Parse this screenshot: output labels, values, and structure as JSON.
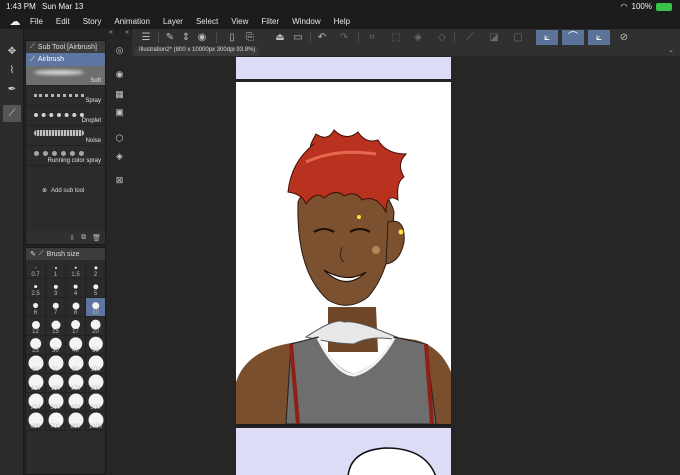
{
  "status": {
    "time": "1:43 PM",
    "date": "Sun Mar 13",
    "battery": "100%"
  },
  "menu": [
    "File",
    "Edit",
    "Story",
    "Animation",
    "Layer",
    "Select",
    "View",
    "Filter",
    "Window",
    "Help"
  ],
  "subtool": {
    "header": "Sub Tool [Airbrush]",
    "group": "Airbrush",
    "brushes": [
      "Soft",
      "Spray",
      "Droplet",
      "Noise",
      "Running color spray"
    ],
    "add_label": "Add sub tool"
  },
  "brushsize": {
    "header": "Brush size",
    "sizes": [
      "0.7",
      "1",
      "1.5",
      "2",
      "2.5",
      "3",
      "4",
      "5",
      "6",
      "7",
      "8",
      "10",
      "12",
      "15",
      "17",
      "20",
      "25",
      "30",
      "40",
      "50",
      "60",
      "70",
      "80",
      "100",
      "120",
      "150",
      "170",
      "200",
      "250",
      "300",
      "400",
      "500",
      "600",
      "700",
      "800",
      "1000"
    ],
    "selected": "10"
  },
  "document": {
    "tab_title": "Illustration2* (800 x 10000px 300dpi 93.9%)"
  },
  "colors": {
    "accent": "#5d75a0",
    "page_tint": "#dcdcf6",
    "hair": "#b8321f",
    "skin": "#7b5130",
    "shirt": "#6e6e6e"
  }
}
